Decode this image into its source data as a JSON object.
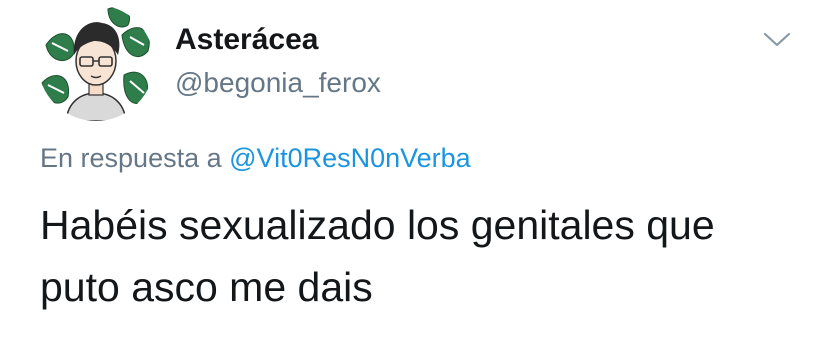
{
  "tweet": {
    "author": {
      "display_name": "Asterácea",
      "handle": "@begonia_ferox"
    },
    "reply": {
      "prefix": "En respuesta a",
      "mention": "@Vit0ResN0nVerba"
    },
    "text_lines": [
      "Habéis sexualizado los genitales que",
      "puto asco me dais"
    ],
    "menu_icon": "chevron-down-icon",
    "colors": {
      "name": "#14171a",
      "secondary": "#657786",
      "link": "#1b95e0"
    }
  }
}
